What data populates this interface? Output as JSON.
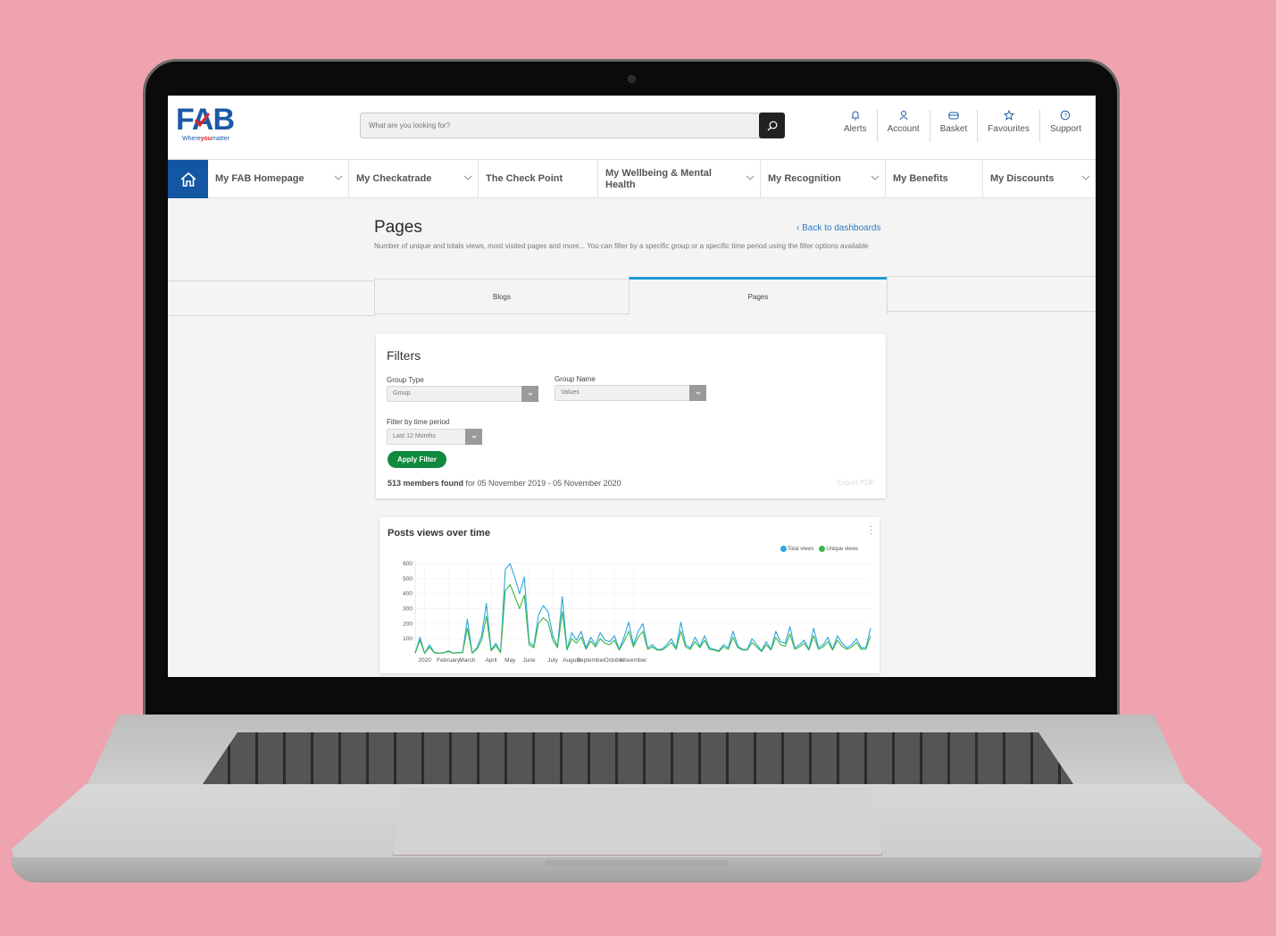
{
  "brand": {
    "logo_prefix": "F",
    "logo_mid": "A",
    "logo_suffix": "B",
    "tagline_before": "Where",
    "tagline_highlight": "you",
    "tagline_after": "matter",
    "primary_color": "#1b59a8",
    "accent_color": "#e2252b"
  },
  "search": {
    "placeholder": "What are you looking for?",
    "icon": "search-icon"
  },
  "header_icons": [
    {
      "label": "Alerts",
      "icon": "bell-icon"
    },
    {
      "label": "Account",
      "icon": "user-icon"
    },
    {
      "label": "Basket",
      "icon": "basket-icon"
    },
    {
      "label": "Favourites",
      "icon": "star-icon"
    },
    {
      "label": "Support",
      "icon": "help-icon"
    }
  ],
  "nav": {
    "home_icon": "home-icon",
    "items": [
      {
        "label": "My FAB Homepage",
        "has_dropdown": true
      },
      {
        "label": "My Checkatrade",
        "has_dropdown": true
      },
      {
        "label": "The Check Point",
        "has_dropdown": false
      },
      {
        "label": "My Wellbeing & Mental Health",
        "has_dropdown": true
      },
      {
        "label": "My Recognition",
        "has_dropdown": true
      },
      {
        "label": "My Benefits",
        "has_dropdown": false
      },
      {
        "label": "My Discounts",
        "has_dropdown": true
      }
    ]
  },
  "page": {
    "title": "Pages",
    "description": "Number of unique and totals views, most visited pages and more... You can filter by a specific group or a specific time period using the filter options available",
    "back_link": "Back to dashboards"
  },
  "tabs": [
    {
      "label": "",
      "active": false
    },
    {
      "label": "Blogs",
      "active": false
    },
    {
      "label": "Pages",
      "active": true
    },
    {
      "label": "",
      "active": false
    }
  ],
  "filters": {
    "title": "Filters",
    "group_type": {
      "label": "Group Type",
      "value": "Group"
    },
    "group_name": {
      "label": "Group Name",
      "value": "Values"
    },
    "time_period": {
      "label": "Filter by time period",
      "value": "Last 12 Months"
    },
    "apply_label": "Apply Filter",
    "result_count": "513 members found",
    "result_range": " for 05 November 2019 - 05 November 2020",
    "export_label": "Export PDF",
    "apply_color": "#0f8a3e"
  },
  "chart_data": {
    "type": "line",
    "title": "Posts views over time",
    "xlabel": "",
    "ylabel": "",
    "ylim": [
      0,
      600
    ],
    "yticks": [
      100,
      200,
      300,
      400,
      500,
      600
    ],
    "grid": true,
    "legend_position": "top-right",
    "x_tick_labels": [
      "2020",
      "February",
      "March",
      "April",
      "May",
      "June",
      "July",
      "August",
      "September",
      "October",
      "November"
    ],
    "x_tick_positions_week": [
      2,
      7,
      11,
      16,
      20,
      24,
      29,
      33,
      37,
      42,
      46
    ],
    "series": [
      {
        "name": "Total views",
        "color": "#2aa7de",
        "values": [
          5,
          110,
          3,
          60,
          10,
          4,
          8,
          20,
          5,
          8,
          10,
          230,
          5,
          40,
          120,
          335,
          25,
          70,
          10,
          560,
          600,
          505,
          400,
          510,
          80,
          50,
          260,
          320,
          280,
          120,
          50,
          380,
          30,
          140,
          90,
          150,
          40,
          110,
          60,
          140,
          90,
          80,
          120,
          30,
          110,
          210,
          60,
          150,
          200,
          40,
          60,
          30,
          30,
          60,
          100,
          40,
          210,
          60,
          40,
          110,
          50,
          120,
          40,
          30,
          20,
          60,
          40,
          150,
          50,
          30,
          30,
          100,
          60,
          20,
          80,
          30,
          150,
          80,
          70,
          180,
          40,
          60,
          90,
          30,
          170,
          40,
          60,
          110,
          30,
          120,
          70,
          40,
          60,
          100,
          40,
          40,
          170
        ]
      },
      {
        "name": "Unique views",
        "color": "#3bb54a",
        "values": [
          4,
          90,
          2,
          45,
          8,
          3,
          6,
          15,
          4,
          6,
          8,
          170,
          4,
          30,
          90,
          250,
          20,
          55,
          8,
          420,
          460,
          380,
          300,
          390,
          60,
          40,
          200,
          240,
          210,
          90,
          40,
          280,
          25,
          100,
          70,
          110,
          30,
          85,
          45,
          100,
          70,
          60,
          90,
          25,
          80,
          150,
          45,
          110,
          150,
          30,
          45,
          25,
          25,
          45,
          75,
          30,
          150,
          45,
          30,
          80,
          40,
          90,
          30,
          25,
          15,
          45,
          30,
          110,
          40,
          25,
          25,
          75,
          45,
          15,
          60,
          25,
          110,
          60,
          50,
          130,
          30,
          45,
          70,
          25,
          120,
          30,
          45,
          80,
          25,
          90,
          50,
          30,
          45,
          75,
          30,
          30,
          120
        ]
      }
    ]
  }
}
